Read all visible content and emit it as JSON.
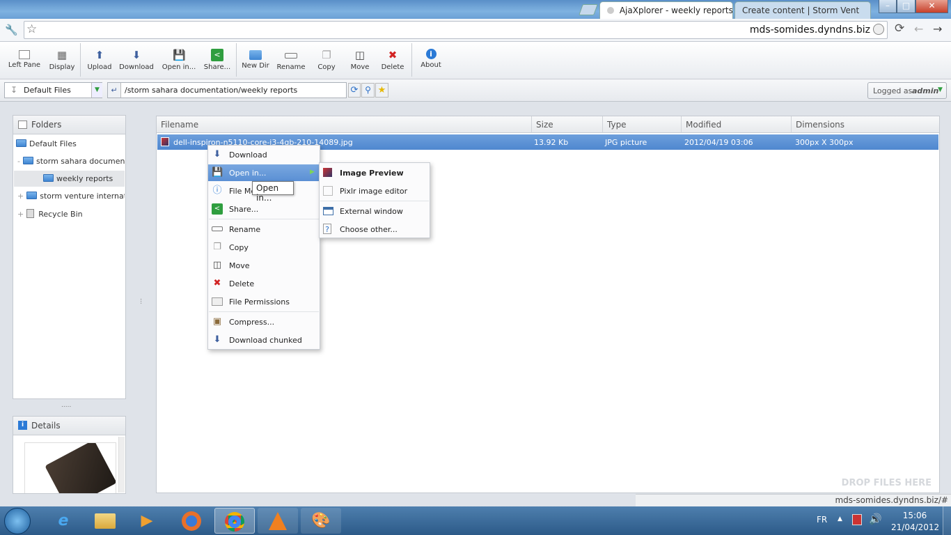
{
  "browser": {
    "tabs": [
      {
        "label": "AjaXplorer - weekly reports"
      },
      {
        "label": "Create content | Storm Vent"
      }
    ],
    "url": "mds-somides.dyndns.biz"
  },
  "toolbar": {
    "buttons": [
      {
        "label": "Left Pane",
        "icon": "left-pane-icon"
      },
      {
        "label": "Display",
        "icon": "display-icon"
      },
      {
        "label": "Upload",
        "icon": "upload-icon"
      },
      {
        "label": "Download",
        "icon": "download-icon"
      },
      {
        "label": "Open in...",
        "icon": "open-in-icon"
      },
      {
        "label": "Share...",
        "icon": "share-icon"
      },
      {
        "label": "New Dir",
        "icon": "new-dir-icon"
      },
      {
        "label": "Rename",
        "icon": "rename-icon"
      },
      {
        "label": "Copy",
        "icon": "copy-icon"
      },
      {
        "label": "Move",
        "icon": "move-icon"
      },
      {
        "label": "Delete",
        "icon": "delete-icon"
      },
      {
        "label": "About",
        "icon": "about-icon"
      }
    ]
  },
  "location": {
    "repository": "Default Files",
    "path": "/storm sahara documentation/weekly reports",
    "logged_as_prefix": "Logged as",
    "user": "admin"
  },
  "folders": {
    "title": "Folders",
    "items": [
      {
        "label": "Default Files"
      },
      {
        "label": "storm sahara documentation"
      },
      {
        "label": "weekly reports"
      },
      {
        "label": "storm venture international"
      },
      {
        "label": "Recycle Bin"
      }
    ],
    "splitter": "....."
  },
  "details": {
    "title": "Details"
  },
  "files": {
    "columns": [
      "Filename",
      "Size",
      "Type",
      "Modified",
      "Dimensions"
    ],
    "rows": [
      {
        "filename": "dell-inspiron-n5110-core-i3-4gb-210-14089.jpg",
        "size": "13.92 Kb",
        "type": "JPG picture",
        "modified": "2012/04/19 03:06",
        "dimensions": "300px X 300px"
      }
    ],
    "drop_hint": "DROP FILES HERE"
  },
  "context_menu": {
    "items": [
      {
        "label": "Download",
        "icon": "download-icon"
      },
      {
        "label": "Open in...",
        "icon": "open-in-icon"
      },
      {
        "label": "File Meta",
        "icon": "info-icon"
      },
      {
        "label": "Share...",
        "icon": "share-icon"
      },
      {
        "label": "Rename",
        "icon": "rename-icon"
      },
      {
        "label": "Copy",
        "icon": "copy-icon"
      },
      {
        "label": "Move",
        "icon": "move-icon"
      },
      {
        "label": "Delete",
        "icon": "delete-icon"
      },
      {
        "label": "File Permissions",
        "icon": "permissions-icon"
      },
      {
        "label": "Compress...",
        "icon": "compress-icon"
      },
      {
        "label": "Download chunked",
        "icon": "download-icon"
      }
    ],
    "submenu": [
      {
        "label": "Image Preview",
        "icon": "image-preview-icon"
      },
      {
        "label": "Pixlr image editor",
        "icon": "pixlr-icon"
      },
      {
        "label": "External window",
        "icon": "external-window-icon"
      },
      {
        "label": "Choose other...",
        "icon": "question-icon"
      }
    ],
    "tooltip": "Open in..."
  },
  "statusbar": {
    "text": "mds-somides.dyndns.biz/#"
  },
  "taskbar": {
    "language": "FR",
    "time": "15:06",
    "date": "21/04/2012"
  },
  "colors": {
    "selection": "#5a8fd4",
    "delete_red": "#d22424",
    "download_blue": "#3d5f9e",
    "share_green": "#2f9e3f"
  }
}
